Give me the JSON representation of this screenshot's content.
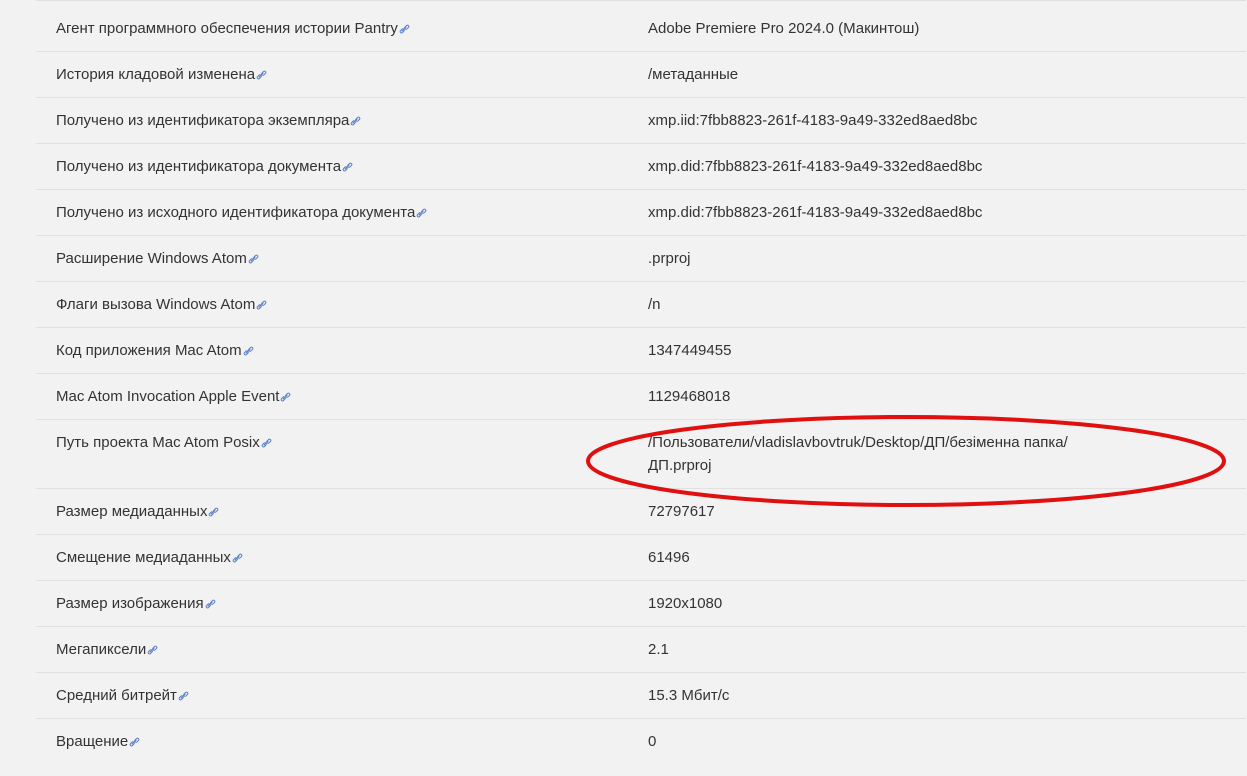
{
  "metadata": {
    "rows": [
      {
        "key": "Агент программного обеспечения истории Pantry",
        "value": "Adobe Premiere Pro 2024.0 (Макинтош)"
      },
      {
        "key": "История кладовой изменена",
        "value": "/метаданные"
      },
      {
        "key": "Получено из идентификатора экземпляра",
        "value": "xmp.iid:7fbb8823-261f-4183-9a49-332ed8aed8bc"
      },
      {
        "key": "Получено из идентификатора документа",
        "value": "xmp.did:7fbb8823-261f-4183-9a49-332ed8aed8bc"
      },
      {
        "key": "Получено из исходного идентификатора документа",
        "value": "xmp.did:7fbb8823-261f-4183-9a49-332ed8aed8bc"
      },
      {
        "key": "Расширение Windows Atom",
        "value": ".prproj"
      },
      {
        "key": "Флаги вызова Windows Atom",
        "value": "/n"
      },
      {
        "key": "Код приложения Mac Atom",
        "value": "1347449455"
      },
      {
        "key": "Mac Atom Invocation Apple Event",
        "value": "1129468018"
      },
      {
        "key": "Путь проекта Mac Atom Posix",
        "value_line1": "/Пользователи/vladislavbovtruk/Desktop/ДП/безіменна папка/",
        "value_line2": "ДП.prproj"
      },
      {
        "key": "Размер медиаданных",
        "value": "72797617"
      },
      {
        "key": "Смещение медиаданных",
        "value": "61496"
      },
      {
        "key": "Размер изображения",
        "value": "1920x1080"
      },
      {
        "key": "Мегапиксели",
        "value": "2.1"
      },
      {
        "key": "Средний битрейт",
        "value": "15.3 Мбит/с"
      },
      {
        "key": "Вращение",
        "value": "0"
      }
    ]
  },
  "colors": {
    "background": "#f2f2f2",
    "text": "#333333",
    "link_icon": "#5b7fc7",
    "annotation": "#e01010"
  },
  "icons": {
    "row_link": "external-link-icon"
  }
}
